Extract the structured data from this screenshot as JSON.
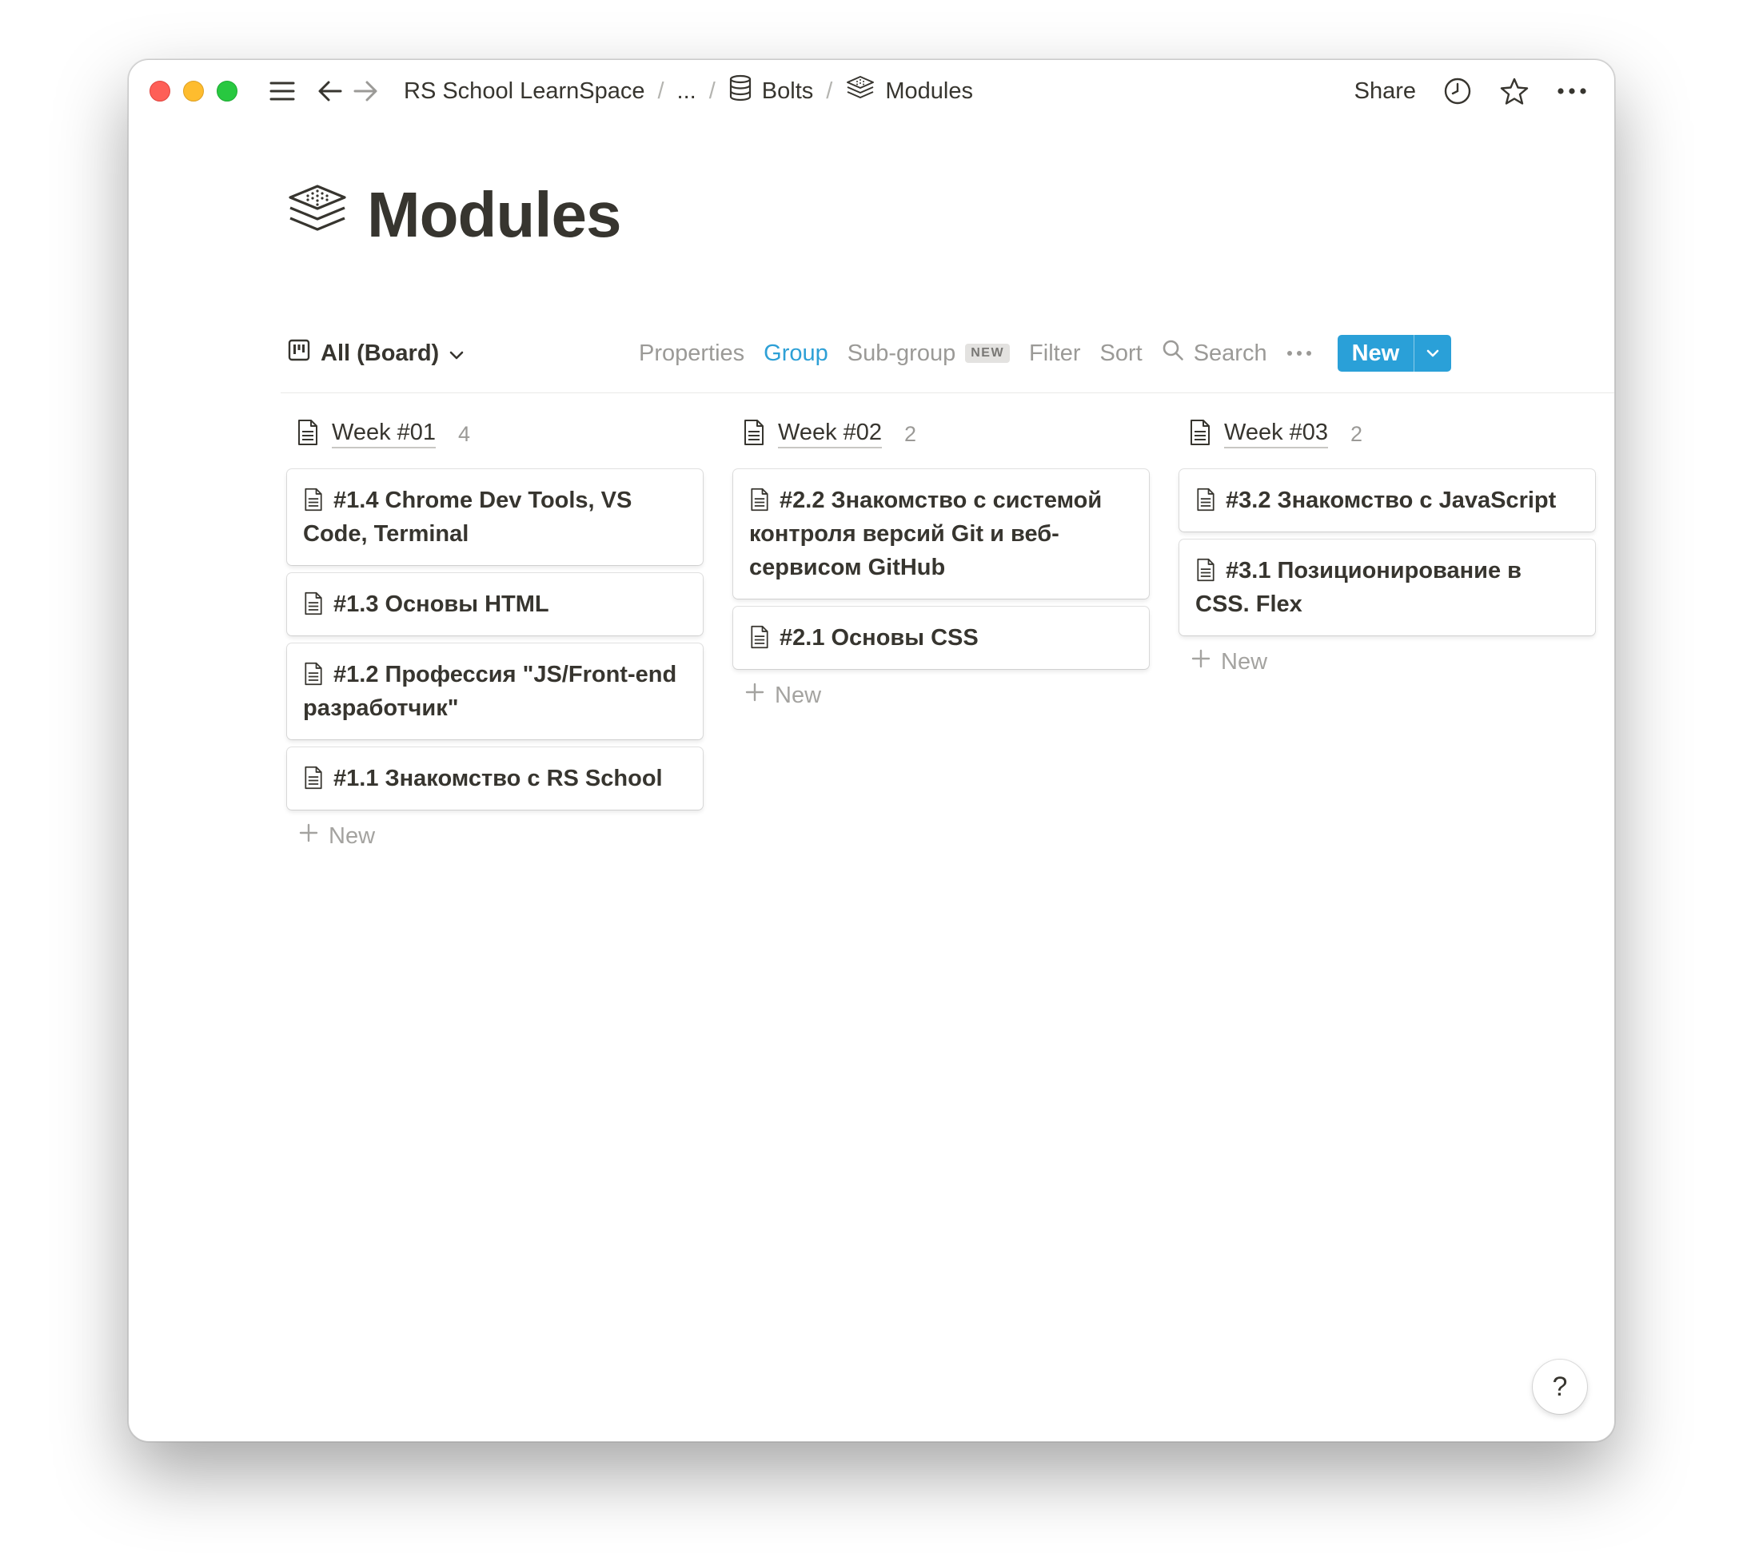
{
  "window": {
    "breadcrumb": {
      "workspace": "RS School LearnSpace",
      "ellipsis": "...",
      "database": "Bolts",
      "page": "Modules",
      "separator": "/"
    },
    "share_label": "Share",
    "icons": [
      "menu-icon",
      "arrow-left-icon",
      "arrow-right-icon",
      "database-icon",
      "layers-icon",
      "clock-icon",
      "star-icon",
      "more-icon"
    ]
  },
  "page": {
    "title": "Modules",
    "icon": "layers-icon"
  },
  "toolbar": {
    "view_label": "All (Board)",
    "properties": "Properties",
    "group": "Group",
    "subgroup": "Sub-group",
    "subgroup_badge": "NEW",
    "filter": "Filter",
    "sort": "Sort",
    "search": "Search",
    "new_button": "New",
    "accent_color": "#2aa0d8"
  },
  "board": {
    "add_new_label": "New",
    "columns": [
      {
        "title": "Week #01",
        "count": "4",
        "cards": [
          "#1.4 Chrome Dev Tools, VS Code, Terminal",
          "#1.3 Основы HTML",
          "#1.2 Профессия \"JS/Front-end разработчик\"",
          "#1.1 Знакомство с RS School"
        ]
      },
      {
        "title": "Week #02",
        "count": "2",
        "cards": [
          "#2.2 Знакомство с системой контроля версий Git и веб-сервисом GitHub",
          "#2.1 Основы CSS"
        ]
      },
      {
        "title": "Week #03",
        "count": "2",
        "cards": [
          "#3.2 Знакомство с JavaScript",
          "#3.1 Позиционирование в CSS. Flex"
        ]
      }
    ]
  },
  "help_label": "?"
}
